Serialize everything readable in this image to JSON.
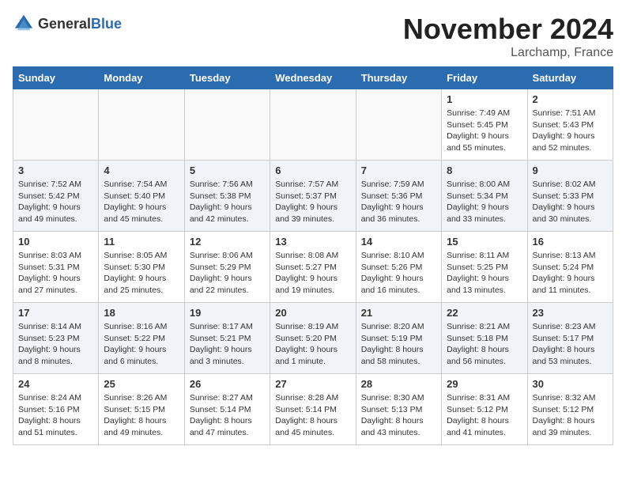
{
  "logo": {
    "text_general": "General",
    "text_blue": "Blue"
  },
  "title": {
    "month": "November 2024",
    "location": "Larchamp, France"
  },
  "headers": [
    "Sunday",
    "Monday",
    "Tuesday",
    "Wednesday",
    "Thursday",
    "Friday",
    "Saturday"
  ],
  "weeks": [
    [
      {
        "day": "",
        "info": ""
      },
      {
        "day": "",
        "info": ""
      },
      {
        "day": "",
        "info": ""
      },
      {
        "day": "",
        "info": ""
      },
      {
        "day": "",
        "info": ""
      },
      {
        "day": "1",
        "info": "Sunrise: 7:49 AM\nSunset: 5:45 PM\nDaylight: 9 hours\nand 55 minutes."
      },
      {
        "day": "2",
        "info": "Sunrise: 7:51 AM\nSunset: 5:43 PM\nDaylight: 9 hours\nand 52 minutes."
      }
    ],
    [
      {
        "day": "3",
        "info": "Sunrise: 7:52 AM\nSunset: 5:42 PM\nDaylight: 9 hours\nand 49 minutes."
      },
      {
        "day": "4",
        "info": "Sunrise: 7:54 AM\nSunset: 5:40 PM\nDaylight: 9 hours\nand 45 minutes."
      },
      {
        "day": "5",
        "info": "Sunrise: 7:56 AM\nSunset: 5:38 PM\nDaylight: 9 hours\nand 42 minutes."
      },
      {
        "day": "6",
        "info": "Sunrise: 7:57 AM\nSunset: 5:37 PM\nDaylight: 9 hours\nand 39 minutes."
      },
      {
        "day": "7",
        "info": "Sunrise: 7:59 AM\nSunset: 5:36 PM\nDaylight: 9 hours\nand 36 minutes."
      },
      {
        "day": "8",
        "info": "Sunrise: 8:00 AM\nSunset: 5:34 PM\nDaylight: 9 hours\nand 33 minutes."
      },
      {
        "day": "9",
        "info": "Sunrise: 8:02 AM\nSunset: 5:33 PM\nDaylight: 9 hours\nand 30 minutes."
      }
    ],
    [
      {
        "day": "10",
        "info": "Sunrise: 8:03 AM\nSunset: 5:31 PM\nDaylight: 9 hours\nand 27 minutes."
      },
      {
        "day": "11",
        "info": "Sunrise: 8:05 AM\nSunset: 5:30 PM\nDaylight: 9 hours\nand 25 minutes."
      },
      {
        "day": "12",
        "info": "Sunrise: 8:06 AM\nSunset: 5:29 PM\nDaylight: 9 hours\nand 22 minutes."
      },
      {
        "day": "13",
        "info": "Sunrise: 8:08 AM\nSunset: 5:27 PM\nDaylight: 9 hours\nand 19 minutes."
      },
      {
        "day": "14",
        "info": "Sunrise: 8:10 AM\nSunset: 5:26 PM\nDaylight: 9 hours\nand 16 minutes."
      },
      {
        "day": "15",
        "info": "Sunrise: 8:11 AM\nSunset: 5:25 PM\nDaylight: 9 hours\nand 13 minutes."
      },
      {
        "day": "16",
        "info": "Sunrise: 8:13 AM\nSunset: 5:24 PM\nDaylight: 9 hours\nand 11 minutes."
      }
    ],
    [
      {
        "day": "17",
        "info": "Sunrise: 8:14 AM\nSunset: 5:23 PM\nDaylight: 9 hours\nand 8 minutes."
      },
      {
        "day": "18",
        "info": "Sunrise: 8:16 AM\nSunset: 5:22 PM\nDaylight: 9 hours\nand 6 minutes."
      },
      {
        "day": "19",
        "info": "Sunrise: 8:17 AM\nSunset: 5:21 PM\nDaylight: 9 hours\nand 3 minutes."
      },
      {
        "day": "20",
        "info": "Sunrise: 8:19 AM\nSunset: 5:20 PM\nDaylight: 9 hours\nand 1 minute."
      },
      {
        "day": "21",
        "info": "Sunrise: 8:20 AM\nSunset: 5:19 PM\nDaylight: 8 hours\nand 58 minutes."
      },
      {
        "day": "22",
        "info": "Sunrise: 8:21 AM\nSunset: 5:18 PM\nDaylight: 8 hours\nand 56 minutes."
      },
      {
        "day": "23",
        "info": "Sunrise: 8:23 AM\nSunset: 5:17 PM\nDaylight: 8 hours\nand 53 minutes."
      }
    ],
    [
      {
        "day": "24",
        "info": "Sunrise: 8:24 AM\nSunset: 5:16 PM\nDaylight: 8 hours\nand 51 minutes."
      },
      {
        "day": "25",
        "info": "Sunrise: 8:26 AM\nSunset: 5:15 PM\nDaylight: 8 hours\nand 49 minutes."
      },
      {
        "day": "26",
        "info": "Sunrise: 8:27 AM\nSunset: 5:14 PM\nDaylight: 8 hours\nand 47 minutes."
      },
      {
        "day": "27",
        "info": "Sunrise: 8:28 AM\nSunset: 5:14 PM\nDaylight: 8 hours\nand 45 minutes."
      },
      {
        "day": "28",
        "info": "Sunrise: 8:30 AM\nSunset: 5:13 PM\nDaylight: 8 hours\nand 43 minutes."
      },
      {
        "day": "29",
        "info": "Sunrise: 8:31 AM\nSunset: 5:12 PM\nDaylight: 8 hours\nand 41 minutes."
      },
      {
        "day": "30",
        "info": "Sunrise: 8:32 AM\nSunset: 5:12 PM\nDaylight: 8 hours\nand 39 minutes."
      }
    ]
  ]
}
